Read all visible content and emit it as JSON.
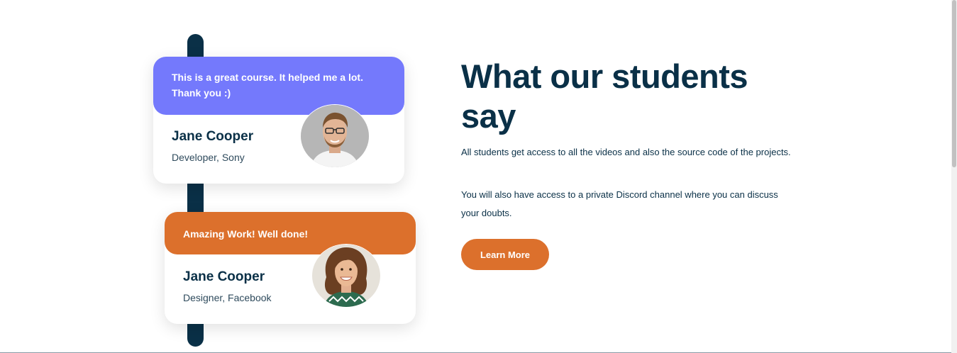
{
  "testimonials": [
    {
      "quote": "This is a great course. It helped me a lot. Thank you :)",
      "name": "Jane Cooper",
      "role": "Developer, Sony",
      "accent_color": "#7479fc"
    },
    {
      "quote": "Amazing Work! Well done!",
      "name": "Jane Cooper",
      "role": "Designer, Facebook",
      "accent_color": "#dc702c"
    }
  ],
  "section": {
    "heading": "What our students say",
    "paragraph_1": "All students get access to all the videos and also the source code of the projects.",
    "paragraph_2": "You will also have access to a private Discord channel where you can discuss your doubts.",
    "button_label": "Learn More"
  },
  "colors": {
    "navy": "#0a3047",
    "purple": "#7479fc",
    "orange": "#dc702c"
  },
  "icons": {
    "avatar_1": "man-avatar-photo",
    "avatar_2": "woman-avatar-photo"
  }
}
